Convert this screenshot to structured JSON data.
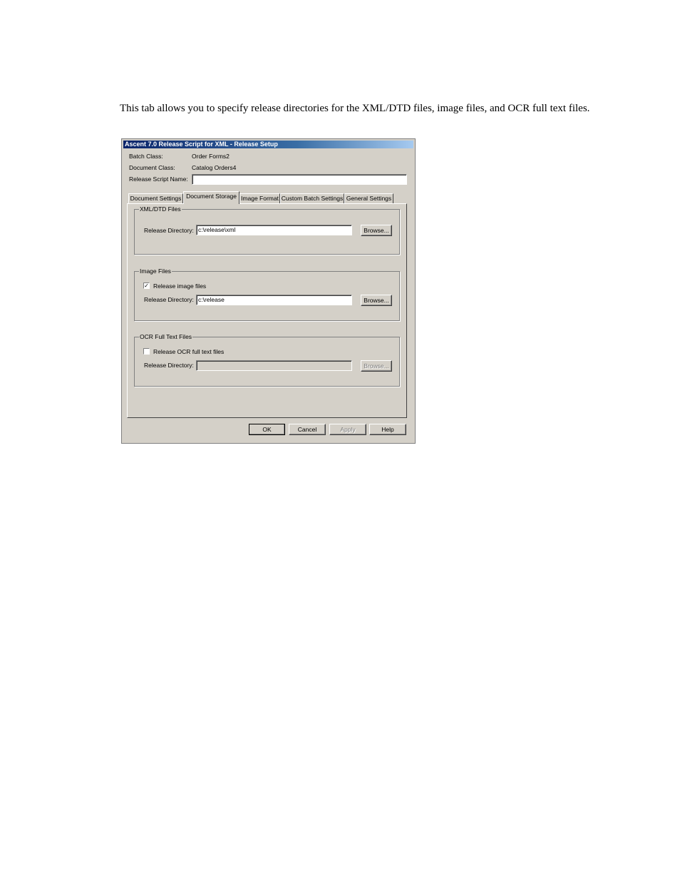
{
  "intro_text": "This tab allows you to specify release directories for the XML/DTD files, image files, and OCR full text files.",
  "dialog": {
    "title": "Ascent 7.0 Release Script for XML - Release Setup",
    "batch_class_label": "Batch Class:",
    "batch_class_value": "Order Forms2",
    "document_class_label": "Document Class:",
    "document_class_value": "Catalog Orders4",
    "release_script_name_label": "Release Script Name:",
    "release_script_name_value": ""
  },
  "tabs": [
    {
      "label": "Document Settings",
      "active": false
    },
    {
      "label": "Document Storage",
      "active": true
    },
    {
      "label": "Image Format",
      "active": false
    },
    {
      "label": "Custom Batch Settings",
      "active": false
    },
    {
      "label": "General Settings",
      "active": false
    }
  ],
  "xml_group": {
    "title": "XML/DTD Files",
    "dir_label": "Release Directory:",
    "dir_value": "c:\\release\\xml",
    "browse_label": "Browse..."
  },
  "image_group": {
    "title": "Image Files",
    "checkbox_label": "Release image files",
    "checked": true,
    "checkmark": "✓",
    "dir_label": "Release Directory:",
    "dir_value": "c:\\release",
    "browse_label": "Browse..."
  },
  "ocr_group": {
    "title": "OCR Full Text Files",
    "checkbox_label": "Release OCR full text files",
    "checked": false,
    "dir_label": "Release Directory:",
    "dir_value": "",
    "browse_label": "Browse..."
  },
  "buttons": {
    "ok": "OK",
    "cancel": "Cancel",
    "apply": "Apply",
    "help": "Help"
  },
  "colors": {
    "dialog_bg": "#d4d0c8",
    "titlebar_start": "#0a246a",
    "titlebar_end": "#a6caf0"
  }
}
